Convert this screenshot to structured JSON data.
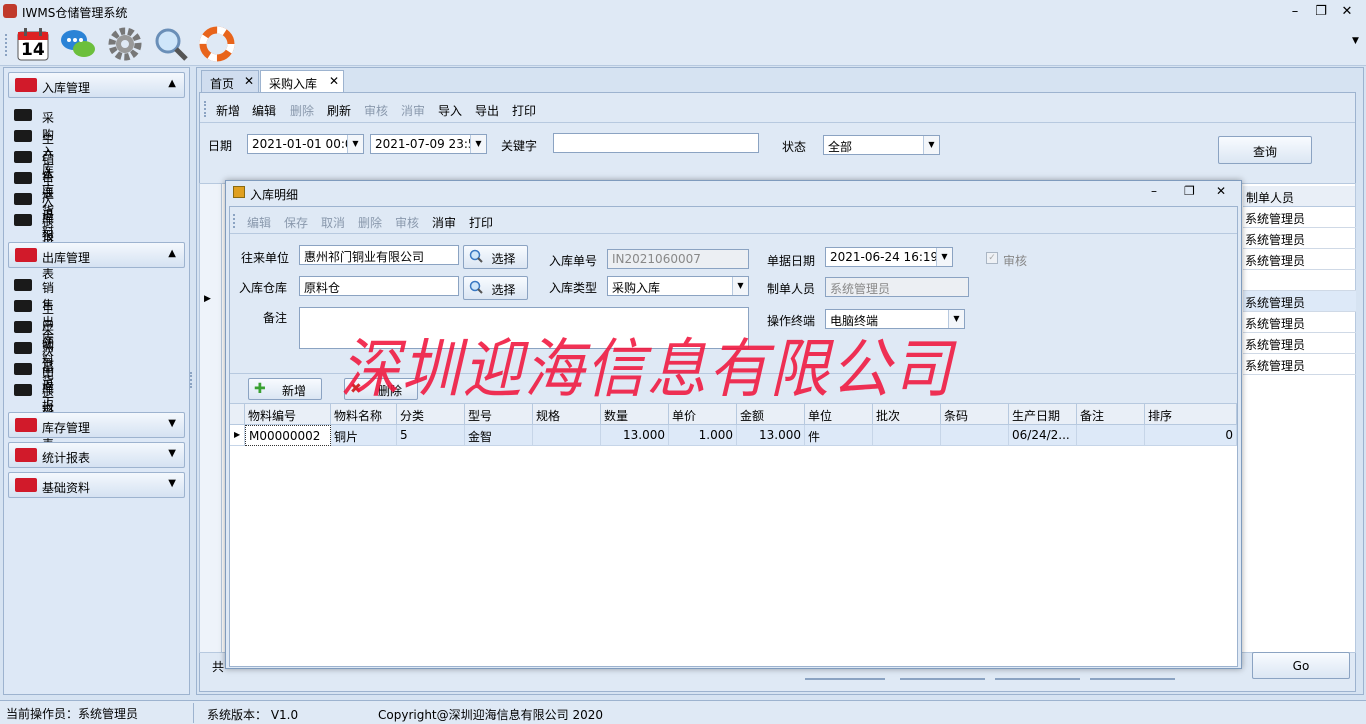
{
  "app": {
    "title": "IWMS仓储管理系统"
  },
  "toolbar": {
    "calendar_day": "14"
  },
  "sidebar": {
    "groups": [
      {
        "label": "入库管理",
        "items": [
          "采购入库",
          "生产入库",
          "销售退货",
          "生产退料",
          "入库报表",
          "退货报表"
        ]
      },
      {
        "label": "出库管理",
        "items": [
          "销售出库",
          "生产领料",
          "采购退货",
          "次品返工",
          "出库报表",
          "退料报表"
        ]
      },
      {
        "label": "库存管理"
      },
      {
        "label": "统计报表"
      },
      {
        "label": "基础资料"
      }
    ]
  },
  "tabs": [
    "首页",
    "采购入库"
  ],
  "main_toolbar": [
    "新增",
    "编辑",
    "删除",
    "刷新",
    "审核",
    "消审",
    "导入",
    "导出",
    "打印"
  ],
  "filters": {
    "date_label": "日期",
    "date_from": "2021-01-01 00:0",
    "date_to": "2021-07-09 23:5",
    "keyword_label": "关键字",
    "keyword_value": "",
    "status_label": "状态",
    "status_value": "全部",
    "query_button": "查询"
  },
  "bg_grid": {
    "header": "制单人员",
    "rows": [
      "系统管理员",
      "系统管理员",
      "系统管理员",
      "",
      "系统管理员",
      "系统管理员",
      "系统管理员",
      "系统管理员"
    ],
    "footer_prefix": "共",
    "go_button": "Go"
  },
  "dialog": {
    "title": "入库明细",
    "toolbar": [
      "编辑",
      "保存",
      "取消",
      "删除",
      "审核",
      "消审",
      "打印"
    ],
    "form": {
      "partner_label": "往来单位",
      "partner_value": "惠州祁门铜业有限公司",
      "select_label": "选择",
      "warehouse_label": "入库仓库",
      "warehouse_value": "原料仓",
      "remark_label": "备注",
      "remark_value": "",
      "doc_no_label": "入库单号",
      "doc_no_value": "IN2021060007",
      "type_label": "入库类型",
      "type_value": "采购入库",
      "doc_date_label": "单据日期",
      "doc_date_value": "2021-06-24 16:19",
      "maker_label": "制单人员",
      "maker_value": "系统管理员",
      "terminal_label": "操作终端",
      "terminal_value": "电脑终端",
      "audit_label": "审核"
    },
    "detail_toolbar": {
      "add": "新增",
      "delete": "删除"
    },
    "columns": [
      "物料编号",
      "物料名称",
      "分类",
      "型号",
      "规格",
      "数量",
      "单价",
      "金额",
      "单位",
      "批次",
      "条码",
      "生产日期",
      "备注",
      "排序"
    ],
    "rows": [
      [
        "M00000002",
        "铜片",
        "5",
        "金智",
        "",
        "13.000",
        "1.000",
        "13.000",
        "件",
        "",
        "",
        "06/24/2...",
        "",
        "0"
      ]
    ]
  },
  "watermark": "深圳迎海信息有限公司",
  "status": {
    "operator": "当前操作员：系统管理员",
    "version": "系统版本：  V1.0",
    "copyright": "Copyright@深圳迎海信息有限公司 2020"
  }
}
